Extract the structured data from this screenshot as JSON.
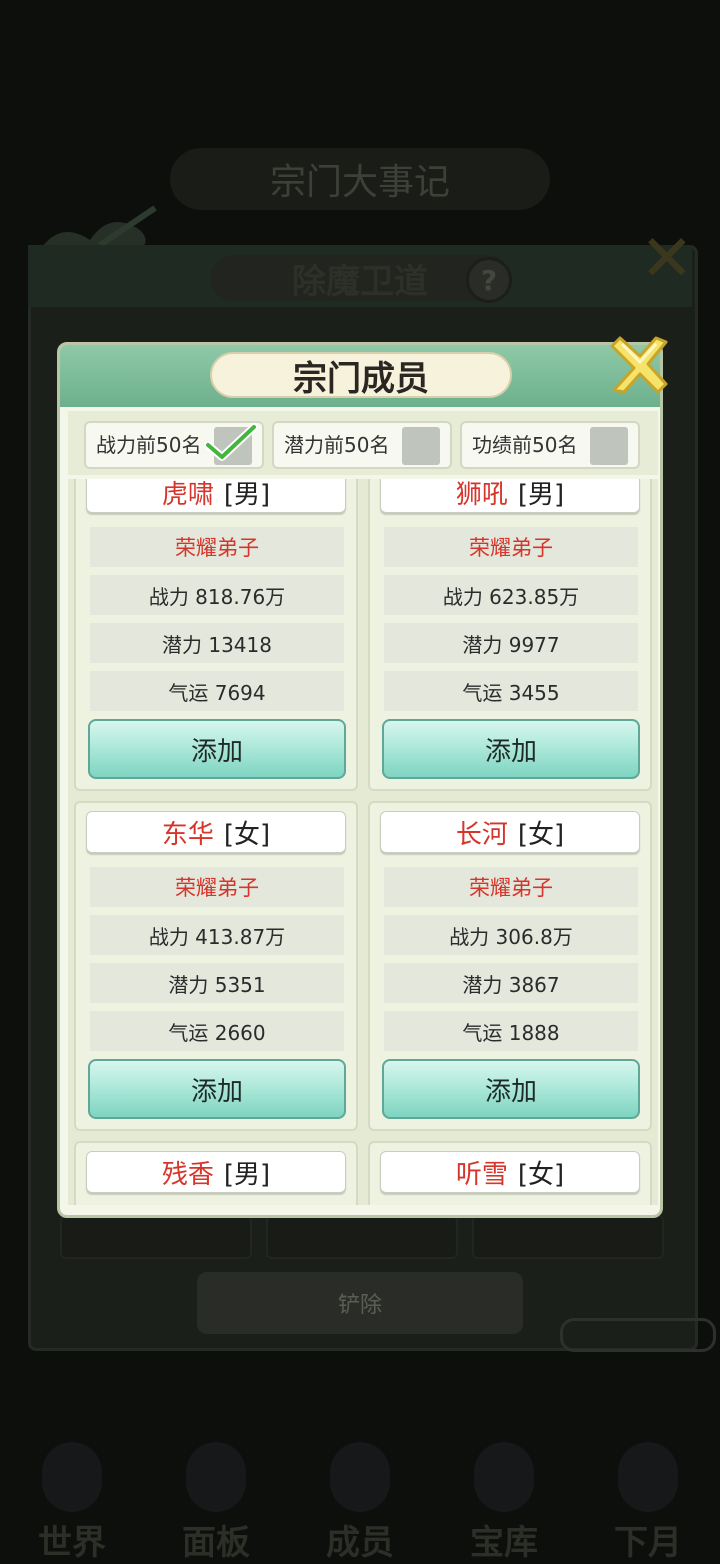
{
  "background": {
    "banner_title": "宗门大事记",
    "panel_title": "除魔卫道",
    "help_label": "?",
    "remove_label": "铲除",
    "bottom_nav": [
      "世界",
      "面板",
      "成员",
      "宝库",
      "下月"
    ]
  },
  "modal": {
    "title": "宗门成员",
    "filters": [
      {
        "label": "战力前50名",
        "checked": true
      },
      {
        "label": "潜力前50名",
        "checked": false
      },
      {
        "label": "功绩前50名",
        "checked": false
      }
    ],
    "members": [
      {
        "name": "虎啸",
        "gender": "[男]",
        "rank": "荣耀弟子",
        "power": "战力 818.76万",
        "potential": "潜力 13418",
        "luck": "气运 7694",
        "button": "添加"
      },
      {
        "name": "狮吼",
        "gender": "[男]",
        "rank": "荣耀弟子",
        "power": "战力 623.85万",
        "potential": "潜力 9977",
        "luck": "气运 3455",
        "button": "添加"
      },
      {
        "name": "东华",
        "gender": "[女]",
        "rank": "荣耀弟子",
        "power": "战力 413.87万",
        "potential": "潜力 5351",
        "luck": "气运 2660",
        "button": "添加"
      },
      {
        "name": "长河",
        "gender": "[女]",
        "rank": "荣耀弟子",
        "power": "战力 306.8万",
        "potential": "潜力 3867",
        "luck": "气运 1888",
        "button": "添加"
      },
      {
        "name": "残香",
        "gender": "[男]"
      },
      {
        "name": "听雪",
        "gender": "[女]"
      }
    ]
  },
  "colors": {
    "accent_red": "#d6352b",
    "header_green": "#7dbd98",
    "button_teal": "#9fe3d3"
  }
}
